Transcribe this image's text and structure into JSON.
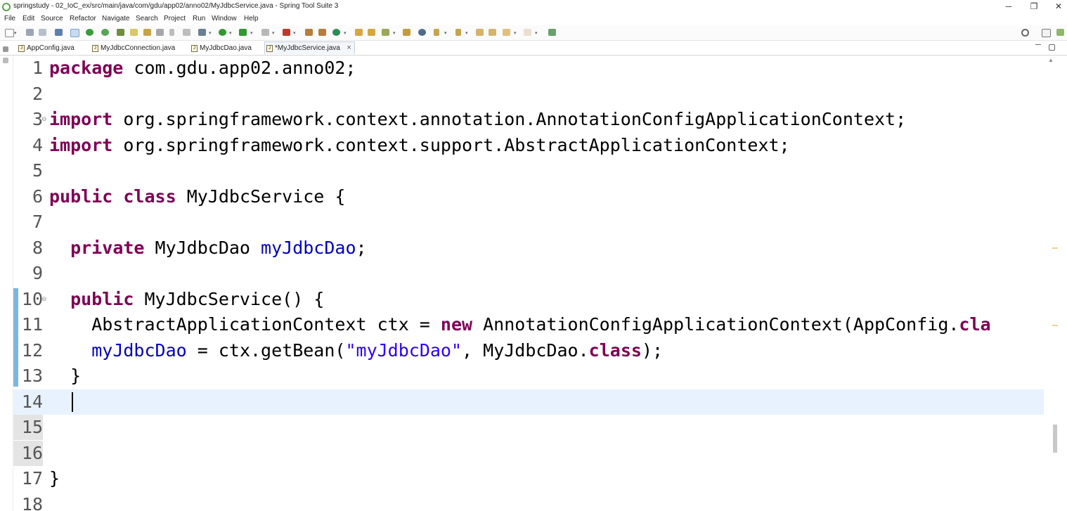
{
  "window": {
    "title": "springstudy - 02_IoC_ex/src/main/java/com/gdu/app02/anno02/MyJdbcService.java - Spring Tool Suite 3",
    "minimize": "─",
    "restore": "❐",
    "close": "✕"
  },
  "menu": [
    "File",
    "Edit",
    "Source",
    "Refactor",
    "Navigate",
    "Search",
    "Project",
    "Run",
    "Window",
    "Help"
  ],
  "tabs": [
    {
      "label": "AppConfig.java"
    },
    {
      "label": "MyJdbcConnection.java"
    },
    {
      "label": "MyJdbcDao.java"
    },
    {
      "label": "*MyJdbcService.java",
      "active": true,
      "close": "×"
    }
  ],
  "tab_icon_glyph": "J",
  "editor": {
    "cursor_line": 14,
    "lines": [
      {
        "n": "1",
        "code": [
          [
            "kw",
            "package"
          ],
          [
            "t",
            " com.gdu.app02.anno02;"
          ]
        ]
      },
      {
        "n": "2",
        "code": []
      },
      {
        "n": "3",
        "code": [
          [
            "kw",
            "import"
          ],
          [
            "t",
            " org.springframework.context.annotation.AnnotationConfigApplicationContext;"
          ]
        ]
      },
      {
        "n": "4",
        "code": [
          [
            "kw",
            "import"
          ],
          [
            "t",
            " org.springframework.context.support.AbstractApplicationContext;"
          ]
        ]
      },
      {
        "n": "5",
        "code": []
      },
      {
        "n": "6",
        "code": [
          [
            "kw",
            "public"
          ],
          [
            "t",
            " "
          ],
          [
            "kw",
            "class"
          ],
          [
            "t",
            " MyJdbcService {"
          ]
        ]
      },
      {
        "n": "7",
        "code": []
      },
      {
        "n": "8",
        "code": [
          [
            "t",
            "  "
          ],
          [
            "kw",
            "private"
          ],
          [
            "t",
            " MyJdbcDao "
          ],
          [
            "fld",
            "myJdbcDao"
          ],
          [
            "t",
            ";"
          ]
        ]
      },
      {
        "n": "9",
        "code": []
      },
      {
        "n": "10",
        "code": [
          [
            "t",
            "  "
          ],
          [
            "kw",
            "public"
          ],
          [
            "t",
            " MyJdbcService() {"
          ]
        ]
      },
      {
        "n": "11",
        "code": [
          [
            "t",
            "    AbstractApplicationContext ctx = "
          ],
          [
            "kw",
            "new"
          ],
          [
            "t",
            " AnnotationConfigApplicationContext(AppConfig."
          ],
          [
            "kw",
            "cla"
          ]
        ]
      },
      {
        "n": "12",
        "code": [
          [
            "t",
            "    "
          ],
          [
            "fld",
            "myJdbcDao"
          ],
          [
            "t",
            " = ctx.getBean("
          ],
          [
            "str",
            "\"myJdbcDao\""
          ],
          [
            "t",
            ", MyJdbcDao."
          ],
          [
            "kw",
            "class"
          ],
          [
            "t",
            ");"
          ]
        ]
      },
      {
        "n": "13",
        "code": [
          [
            "t",
            "  }"
          ]
        ]
      },
      {
        "n": "14",
        "code": [
          [
            "t",
            "  "
          ]
        ]
      },
      {
        "n": "15",
        "code": []
      },
      {
        "n": "16",
        "code": []
      },
      {
        "n": "17",
        "code": [
          [
            "t",
            "}"
          ]
        ]
      },
      {
        "n": "18",
        "code": []
      }
    ]
  },
  "colors": {
    "keyword": "#7f0055",
    "field": "#0000c0",
    "string": "#2a00ff",
    "current_line": "#e8f2fe",
    "change_bar": "#7db6dd"
  }
}
